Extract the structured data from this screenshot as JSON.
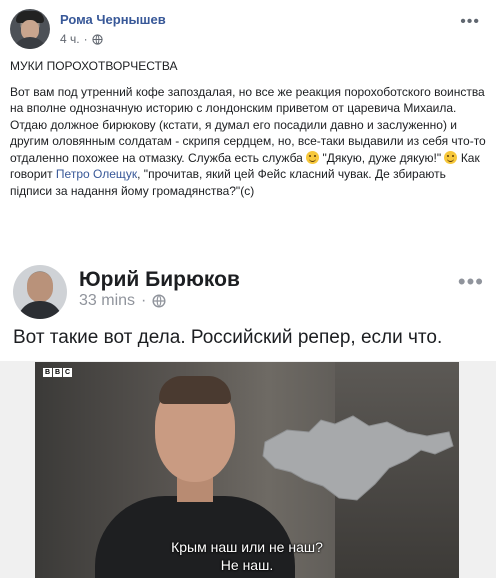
{
  "post": {
    "author": "Рома Чернышев",
    "time": "4 ч.",
    "separator": "·",
    "more": "•••",
    "title": "МУКИ ПОРОХОТВОРЧЕСТВА",
    "paragraph_part1": "Вот вам под утренний кофе запоздалая, но все же реакция порохоботского воинства на вполне однозначную историю с лондонским приветом от царевича Михаила. Отдаю должное бирюкову (кстати, я думал его посадили давно и заслуженно) и другим оловянным солдатам - скрипя сердцем, но, все-таки выдавили из себя что-то отдаленно похожее на отмазку. Служба есть служба",
    "paragraph_part2": " \"Дякую, дуже дякую!\" ",
    "paragraph_part3": "Как говорит ",
    "mention": "Петро Олещук",
    "paragraph_part4": ", \"прочитав, який цей Фейс класний чувак. Де збирають підписи за надання йому громадянства?\"(с)",
    "icons": [
      "globe-icon",
      "smile-emoji-icon",
      "more-icon"
    ]
  },
  "shared": {
    "author": "Юрий Бирюков",
    "time": "33 mins",
    "separator": "·",
    "more": "•••",
    "text": "Вот такие вот дела. Российский репер, если что."
  },
  "video": {
    "logo_letters": [
      "B",
      "B",
      "C"
    ],
    "subtitle_line1": "Крым наш или не наш?",
    "subtitle_line2": "Не наш.",
    "map_color": "#a7a9ab"
  },
  "colors": {
    "link": "#385898",
    "meta": "#616770"
  }
}
